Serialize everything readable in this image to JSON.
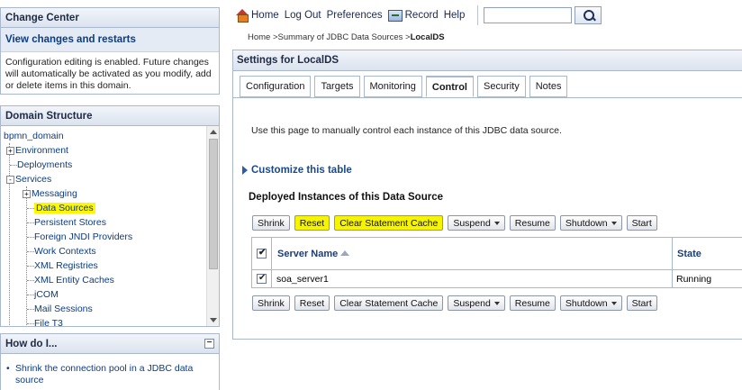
{
  "change_center": {
    "title": "Change Center",
    "view_link": "View changes and restarts",
    "description": "Configuration editing is enabled. Future changes will automatically be activated as you modify, add or delete items in this domain."
  },
  "domain_structure": {
    "title": "Domain Structure",
    "root": "bpmn_domain",
    "items": [
      {
        "label": "Environment",
        "expander": "+"
      },
      {
        "label": "Deployments",
        "expander": ""
      },
      {
        "label": "Services",
        "expander": "-"
      },
      {
        "label": "Messaging",
        "expander": "+"
      },
      {
        "label": "Data Sources",
        "expander": "",
        "highlighted": true
      },
      {
        "label": "Persistent Stores",
        "expander": ""
      },
      {
        "label": "Foreign JNDI Providers",
        "expander": ""
      },
      {
        "label": "Work Contexts",
        "expander": ""
      },
      {
        "label": "XML Registries",
        "expander": ""
      },
      {
        "label": "XML Entity Caches",
        "expander": ""
      },
      {
        "label": "jCOM",
        "expander": ""
      },
      {
        "label": "Mail Sessions",
        "expander": ""
      },
      {
        "label": "File T3",
        "expander": ""
      }
    ]
  },
  "how_do_i": {
    "title": "How do I...",
    "items": [
      "Shrink the connection pool in a JDBC data source"
    ]
  },
  "topbar": {
    "home": "Home",
    "logout": "Log Out",
    "preferences": "Preferences",
    "record": "Record",
    "help": "Help",
    "search_value": ""
  },
  "breadcrumb": {
    "prefix": "Home >Summary of JDBC Data Sources >",
    "current": "LocalDS"
  },
  "settings": {
    "title": "Settings for LocalDS",
    "tabs": [
      "Configuration",
      "Targets",
      "Monitoring",
      "Control",
      "Security",
      "Notes"
    ],
    "active_tab": "Control",
    "intro": "Use this page to manually control each instance of this JDBC data source.",
    "customize": "Customize this table",
    "section_title": "Deployed Instances of this Data Source",
    "buttons": {
      "shrink": "Shrink",
      "reset": "Reset",
      "clear_cache": "Clear Statement Cache",
      "suspend": "Suspend",
      "resume": "Resume",
      "shutdown": "Shutdown",
      "start": "Start"
    },
    "table": {
      "columns": [
        "Server Name",
        "State"
      ],
      "rows": [
        {
          "server": "soa_server1",
          "state": "Running",
          "checked": true
        }
      ]
    }
  }
}
